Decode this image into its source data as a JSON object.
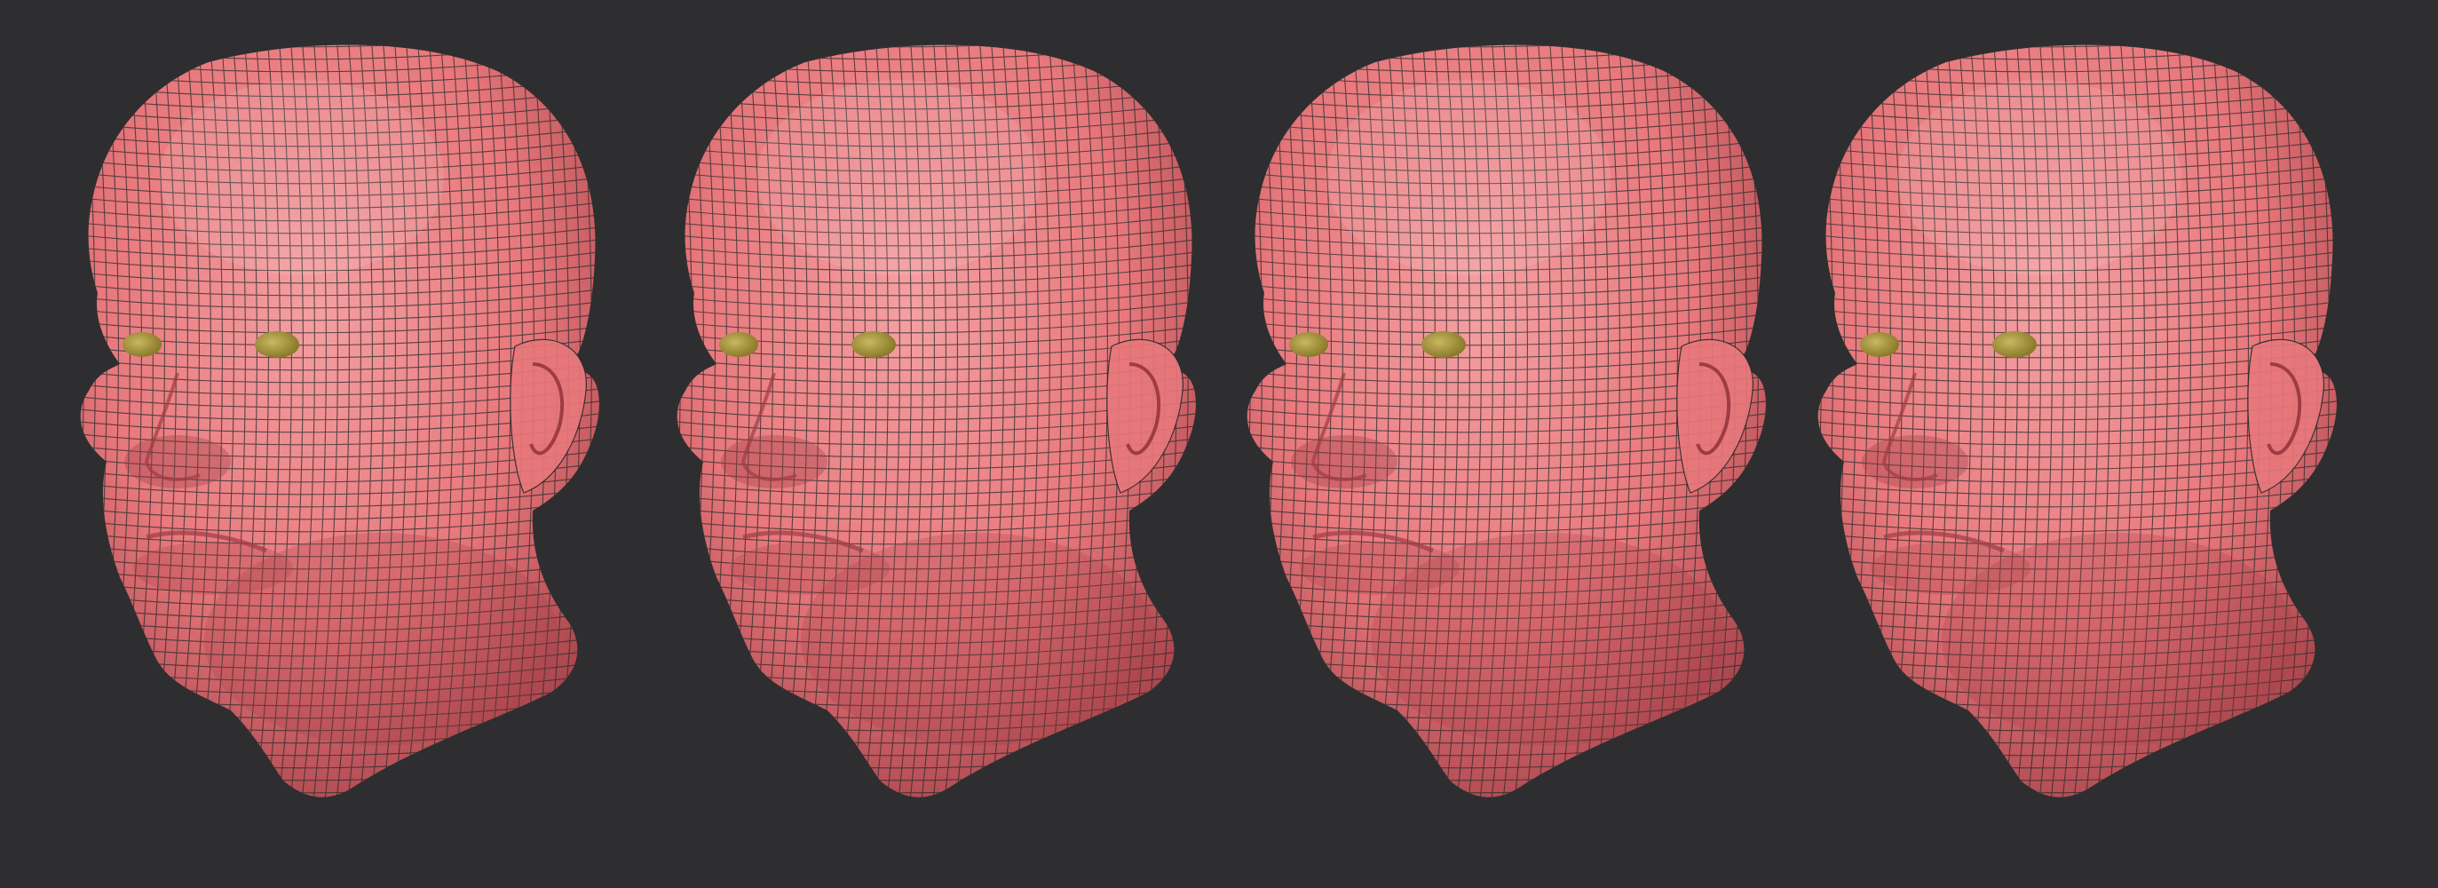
{
  "scene": {
    "background_color": "#2e2e30",
    "material": {
      "skin_color": "#e8787c",
      "skin_highlight": "#f4a0a2",
      "skin_shadow": "#9e3c44",
      "wire_color": "#2a2a2a",
      "eye_color": "#8a7a2a"
    },
    "heads": [
      {
        "id": "head-1",
        "icon": "wireframe-head-model"
      },
      {
        "id": "head-2",
        "icon": "wireframe-head-model"
      },
      {
        "id": "head-3",
        "icon": "wireframe-head-model"
      },
      {
        "id": "head-4",
        "icon": "wireframe-head-model"
      }
    ]
  }
}
